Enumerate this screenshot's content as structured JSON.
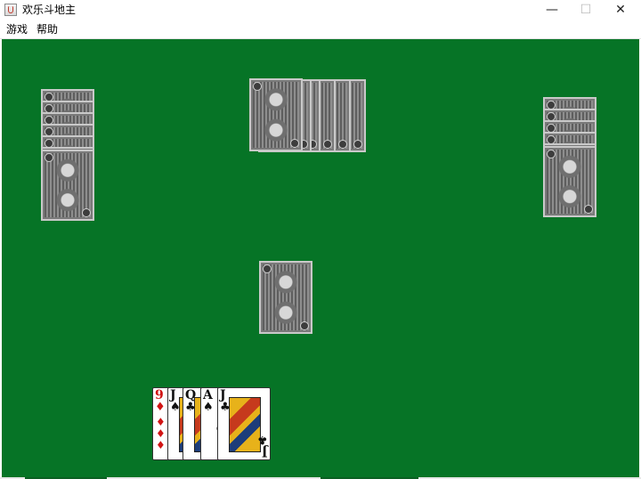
{
  "window": {
    "title": "欢乐斗地主",
    "controls": {
      "minimize": "—",
      "maximize": "☐",
      "close": "✕"
    }
  },
  "menu": {
    "items": [
      {
        "label": "游戏"
      },
      {
        "label": "帮助"
      }
    ]
  },
  "table": {
    "background_color": "#067426",
    "left_player": {
      "card_count": 7
    },
    "top_player": {
      "card_count": 6
    },
    "right_player": {
      "card_count": 6
    },
    "center_pile": {
      "card_count": 1
    },
    "hand": {
      "cards": [
        {
          "rank": "9",
          "suit": "♦",
          "color": "red"
        },
        {
          "rank": "J",
          "suit": "♠",
          "color": "black"
        },
        {
          "rank": "Q",
          "suit": "♣",
          "color": "black"
        },
        {
          "rank": "A",
          "suit": "♠",
          "color": "black"
        },
        {
          "rank": "J",
          "suit": "♣",
          "color": "black"
        }
      ]
    }
  }
}
